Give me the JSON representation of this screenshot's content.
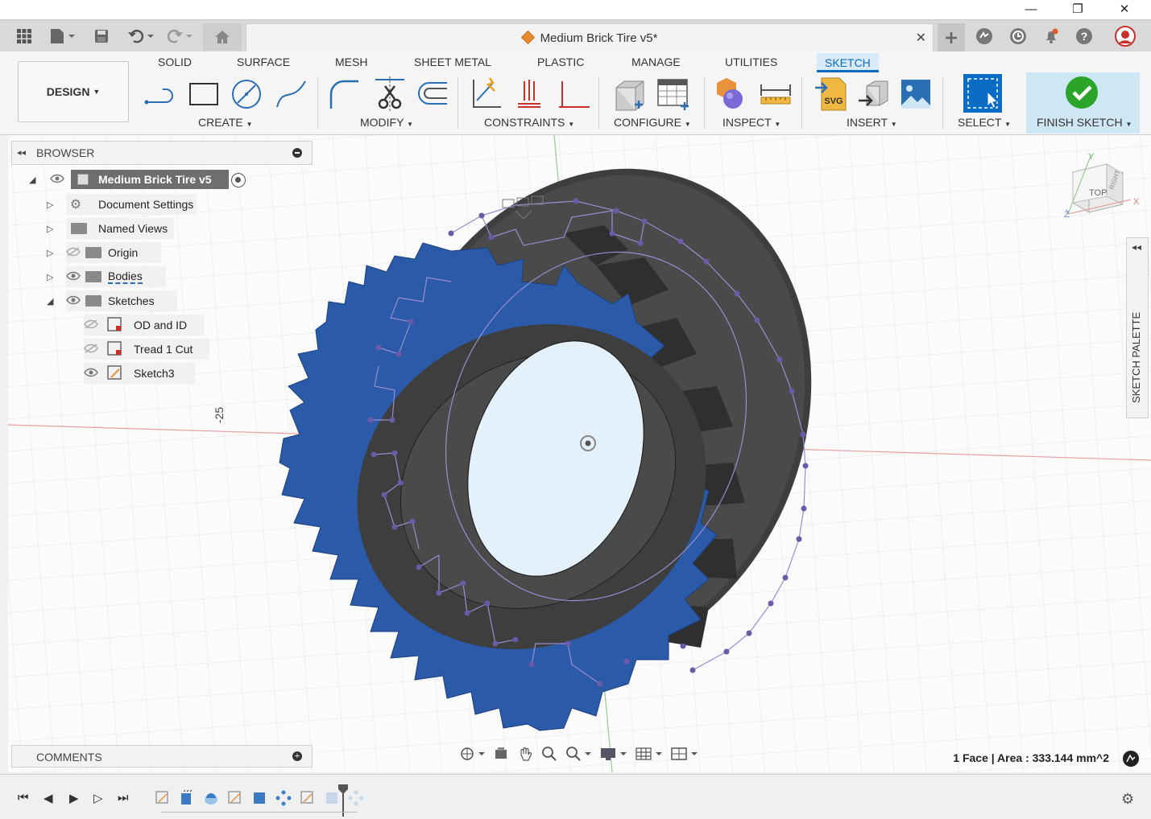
{
  "window": {
    "minimize": "—",
    "restore": "❐",
    "close": "✕"
  },
  "appbar": {
    "doc_title": "Medium Brick Tire v5*",
    "close_tab": "✕"
  },
  "toolbar": {
    "design_label": "DESIGN",
    "tabs": [
      "SOLID",
      "SURFACE",
      "MESH",
      "SHEET METAL",
      "PLASTIC",
      "MANAGE",
      "UTILITIES",
      "SKETCH"
    ],
    "groups": [
      "CREATE",
      "MODIFY",
      "CONSTRAINTS",
      "CONFIGURE",
      "INSPECT",
      "INSERT",
      "SELECT",
      "FINISH SKETCH"
    ]
  },
  "browser": {
    "header": "BROWSER",
    "root": "Medium Brick Tire v5",
    "items": [
      "Document Settings",
      "Named Views",
      "Origin",
      "Bodies",
      "Sketches",
      "OD and ID",
      "Tread 1 Cut",
      "Sketch3"
    ]
  },
  "viewcube": {
    "top": "TOP",
    "right": "RIGHT",
    "x": "X",
    "y": "Y",
    "z": "Z"
  },
  "dimension_label": "-25",
  "sketch_palette": "SKETCH PALETTE",
  "comments": {
    "header": "COMMENTS"
  },
  "status": "1 Face | Area : 333.144 mm^2"
}
